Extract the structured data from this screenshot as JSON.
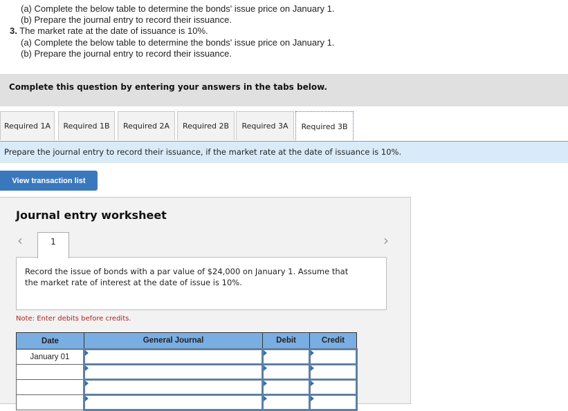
{
  "instructions": {
    "lines": [
      {
        "prefix": "",
        "text": "(a) Complete the below table to determine the bonds' issue price on January 1.",
        "indent": true
      },
      {
        "prefix": "",
        "text": "(b) Prepare the journal entry to record their issuance.",
        "indent": true
      },
      {
        "prefix": "3.",
        "text": " The market rate at the date of issuance is 10%.",
        "indent": false
      },
      {
        "prefix": "",
        "text": "(a) Complete the below table to determine the bonds' issue price on January 1.",
        "indent": true
      },
      {
        "prefix": "",
        "text": "(b) Prepare the journal entry to record their issuance.",
        "indent": true
      }
    ]
  },
  "banner": {
    "text": "Complete this question by entering your answers in the tabs below."
  },
  "tabs": [
    {
      "label": "Required 1A",
      "active": false
    },
    {
      "label": "Required 1B",
      "active": false
    },
    {
      "label": "Required 2A",
      "active": false
    },
    {
      "label": "Required 2B",
      "active": false
    },
    {
      "label": "Required 3A",
      "active": false
    },
    {
      "label": "Required 3B",
      "active": true
    }
  ],
  "prompt": "Prepare the journal entry to record their issuance, if the market rate at the date of issuance is 10%.",
  "view_transactions_label": "View transaction list",
  "worksheet": {
    "title": "Journal entry worksheet",
    "prev_icon": "‹",
    "next_icon": "›",
    "current_entry": "1",
    "description": "Record the issue of bonds with a par value of $24,000 on January 1. Assume that the market rate of interest at the date of issue is 10%.",
    "note": "Note: Enter debits before credits.",
    "table": {
      "headers": {
        "date": "Date",
        "general_journal": "General Journal",
        "debit": "Debit",
        "credit": "Credit"
      },
      "rows": [
        {
          "date": "January 01",
          "account": "",
          "debit": "",
          "credit": ""
        },
        {
          "date": "",
          "account": "",
          "debit": "",
          "credit": ""
        },
        {
          "date": "",
          "account": "",
          "debit": "",
          "credit": ""
        },
        {
          "date": "",
          "account": "",
          "debit": "",
          "credit": ""
        }
      ]
    }
  },
  "colors": {
    "accent": "#3a78be",
    "header_blue": "#7aaee3",
    "prompt_bg": "#d9ebf8",
    "note_red": "#b22222"
  }
}
